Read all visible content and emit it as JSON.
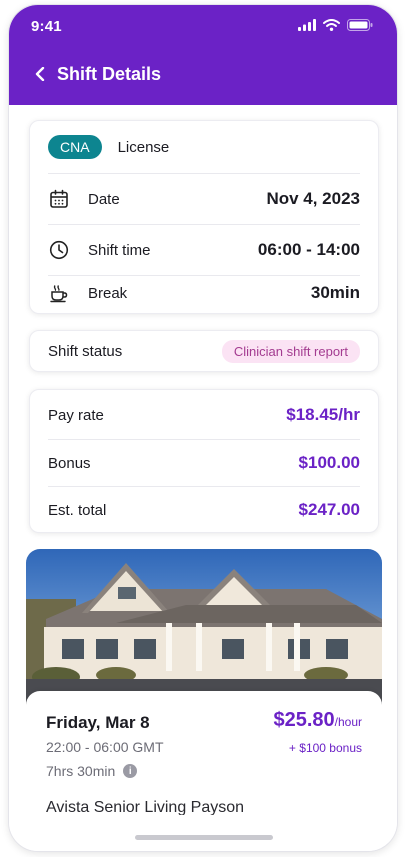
{
  "status_bar": {
    "time": "9:41"
  },
  "header": {
    "title": "Shift Details"
  },
  "shift_card": {
    "badge": "CNA",
    "license": "License",
    "rows": [
      {
        "icon": "calendar-icon",
        "label": "Date",
        "value": "Nov 4, 2023"
      },
      {
        "icon": "clock-icon",
        "label": "Shift time",
        "value": "06:00 - 14:00"
      },
      {
        "icon": "coffee-cup-icon",
        "label": "Break",
        "value": "30min"
      }
    ]
  },
  "status_card": {
    "label": "Shift status",
    "value": "Clinician shift report"
  },
  "pay_card": {
    "rows": [
      {
        "label": "Pay rate",
        "value": "$18.45/hr"
      },
      {
        "label": "Bonus",
        "value": "$100.00"
      },
      {
        "label": "Est. total",
        "value": "$247.00"
      }
    ]
  },
  "job_card": {
    "day": "Friday, Mar 8",
    "time": "22:00 - 06:00 GMT",
    "duration": "7hrs 30min",
    "rate": "$25.80",
    "rate_unit": "/hour",
    "bonus": "+ $100 bonus",
    "facility": "Avista Senior Living Payson"
  },
  "colors": {
    "primary": "#6b22c6",
    "badge_teal": "#0d8590",
    "pill_bg": "#fbe3f4",
    "pill_text": "#a33b90"
  }
}
